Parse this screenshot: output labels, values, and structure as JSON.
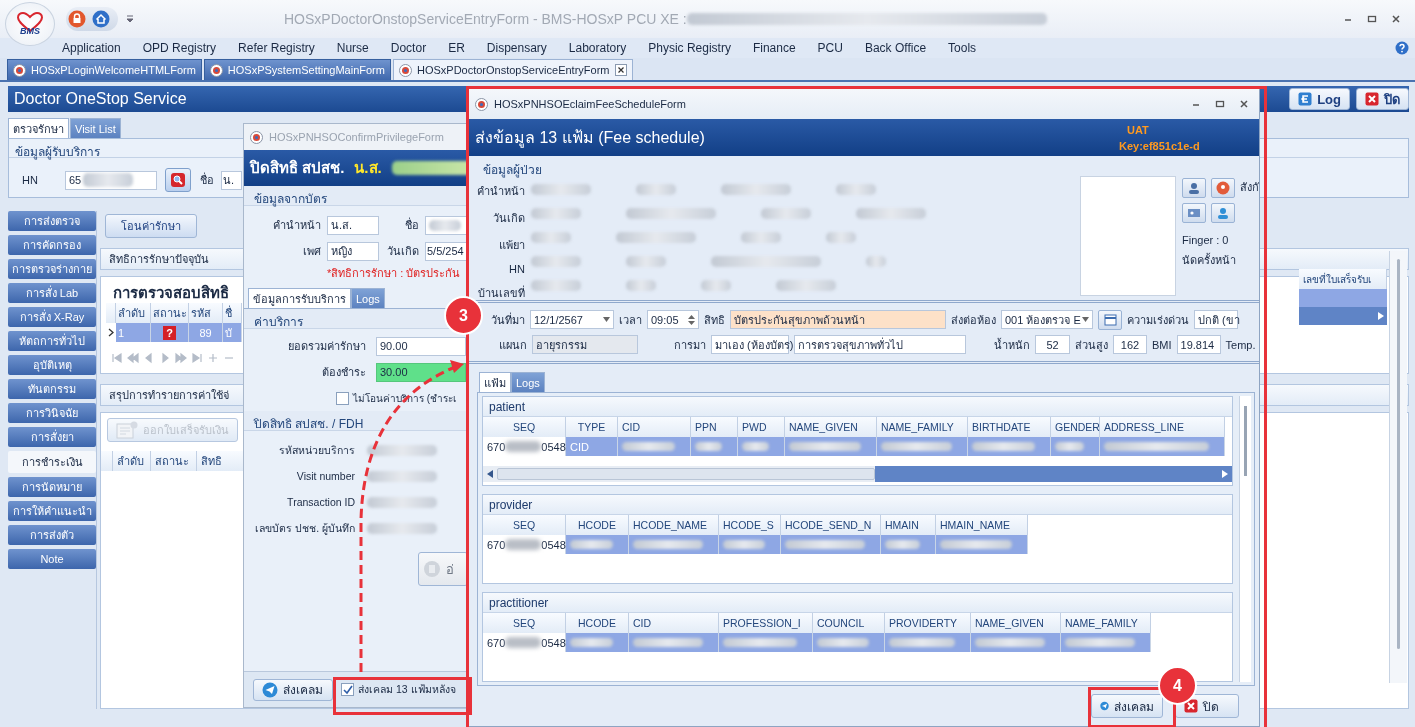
{
  "app_window": {
    "logo": "BMS",
    "title": "HOSxPDoctorOnstopServiceEntryForm - BMS-HOSxP PCU XE :"
  },
  "menu": [
    "Application",
    "OPD Registry",
    "Refer Registry",
    "Nurse",
    "Doctor",
    "ER",
    "Dispensary",
    "Laboratory",
    "Physic Registry",
    "Finance",
    "PCU",
    "Back Office",
    "Tools"
  ],
  "doc_tabs": [
    {
      "label": "HOSxPLoginWelcomeHTMLForm",
      "selected": false
    },
    {
      "label": "HOSxPSystemSettingMainForm",
      "selected": false
    },
    {
      "label": "HOSxPDoctorOnstopServiceEntryForm",
      "selected": true
    }
  ],
  "service": {
    "title": "Doctor OneStop Service",
    "buttons": [
      {
        "label": "Log",
        "kind": "log"
      },
      {
        "label": "ปิด",
        "kind": "close"
      }
    ],
    "tabs": [
      {
        "label": "ตรวจรักษา",
        "selected": true
      },
      {
        "label": "Visit List",
        "selected": false
      }
    ],
    "patient_group": {
      "title": "ข้อมูลผู้รับบริการ",
      "hn_label": "HN",
      "hn_value": "65",
      "name_label": "ชื่อ",
      "name_value": "น."
    },
    "nav": [
      {
        "label": "การส่งตรวจ",
        "selected": false
      },
      {
        "label": "การคัดกรอง",
        "selected": false
      },
      {
        "label": "การตรวจร่างกาย",
        "selected": false
      },
      {
        "label": "การสั่ง Lab",
        "selected": false
      },
      {
        "label": "การสั่ง X-Ray",
        "selected": false
      },
      {
        "label": "หัตถการทั่วไป",
        "selected": false
      },
      {
        "label": "อุบัติเหตุ",
        "selected": false
      },
      {
        "label": "ทันตกรรม",
        "selected": false
      },
      {
        "label": "การวินิจฉัย",
        "selected": false
      },
      {
        "label": "การสั่งยา",
        "selected": false
      },
      {
        "label": "การชำระเงิน",
        "selected": true
      },
      {
        "label": "การนัดหมาย",
        "selected": false
      },
      {
        "label": "การให้คำแนะนำ",
        "selected": false
      },
      {
        "label": "การส่งตัว",
        "selected": false
      },
      {
        "label": "Note",
        "selected": false
      }
    ],
    "transfer_button": "โอนค่ารักษา",
    "rights_panel": {
      "title": "สิทธิการรักษาปัจจุบัน",
      "grid_title": "การตรวจสอบสิทธิ",
      "columns": [
        "ลำดับ",
        "สถานะ",
        "รหัส",
        "ชื่"
      ],
      "rows": [
        {
          "selected": true,
          "cells": [
            "1",
            "?",
            "89",
            "บั"
          ]
        }
      ]
    },
    "receipt_grid": {
      "columns": [
        "เลขที่ใบเสร็จรับเ"
      ],
      "rows": [
        {
          "selected": true
        }
      ]
    },
    "expense_panel": {
      "title": "สรุปการทำรายการค่าใช้จ่",
      "receipt_button": {
        "label": "ออกใบเสร็จรับเงิน",
        "disabled": true
      },
      "columns": [
        "ลำดับ",
        "สถานะ",
        "สิทธิ"
      ]
    }
  },
  "privilege_window": {
    "title": "HOSxPNHSOConfirmPrivilegeForm",
    "heading": "ปิดสิทธิ สปสช.",
    "heading_name": "น.ส.",
    "card_group": "ข้อมูลจากบัตร",
    "prefix": {
      "label": "คำนำหน้า",
      "value": "น.ส."
    },
    "first_name": {
      "label": "ชื่อ"
    },
    "sex": {
      "label": "เพศ",
      "value": "หญิง"
    },
    "birth": {
      "label": "วันเกิด",
      "value": "5/5/254"
    },
    "right_note": "*สิทธิการรักษา : บัตรประกัน",
    "tabs": [
      {
        "label": "ข้อมูลการรับบริการ",
        "selected": true
      },
      {
        "label": "Logs",
        "selected": false
      }
    ],
    "fee_group": "ค่าบริการ",
    "total": {
      "label": "ยอดรวมค่ารักษา",
      "value": "90.00"
    },
    "payable": {
      "label": "ต้องชำระ",
      "value": "30.00"
    },
    "no_transfer": {
      "label": "ไม่โอนค่าบริการ (ชำระเ",
      "checked": false
    },
    "close_group": "ปิดสิทธิ สปสช. / FDH",
    "close_fields": [
      "รหัสหน่วยบริการ",
      "Visit number",
      "Transaction ID",
      "เลขบัตร ปชช. ผู้บันทึก"
    ],
    "read_button": {
      "label": "อ่",
      "disabled": true
    },
    "claim_button": "ส่งเคลม",
    "send13": {
      "label": "ส่งเคลม 13 แฟ้มหลังจ",
      "checked": true
    }
  },
  "fee_window": {
    "title": "HOSxPNHSOEclaimFeeScheduleForm",
    "heading": "ส่งข้อมูล 13 แฟ้ม (Fee schedule)",
    "env": "UAT",
    "key": "Key:ef851c1e-d",
    "patient_group": "ข้อมูลผู้ป่วย",
    "patient_labels": [
      "คำนำหน้า",
      "วันเกิด",
      "แพ้ยา",
      "HN",
      "บ้านเลขที่"
    ],
    "affiliation": "สังกั",
    "finger": "Finger : 0",
    "next_appt": "นัดครั้งหน้า",
    "visit_date": {
      "label": "วันที่มา",
      "value": "12/1/2567"
    },
    "time": {
      "label": "เวลา",
      "value": "09:05"
    },
    "right": {
      "label": "สิทธิ",
      "value": "บัตรประกันสุขภาพถ้วนหน้า"
    },
    "room": {
      "label": "ส่งต่อห้อง",
      "value": "001 ห้องตรวจ E"
    },
    "urgency": {
      "label": "ความเร่งด่วน",
      "value": "ปกติ (ขา"
    },
    "dept": {
      "label": "แผนก",
      "value": "อายุรกรรม"
    },
    "arrival": {
      "label": "การมา",
      "value": "มาเอง (ห้องบัตร)",
      "detail": "การตรวจสุขภาพทั่วไป"
    },
    "weight": {
      "label": "น้ำหนัก",
      "value": "52"
    },
    "height": {
      "label": "ส่วนสูง",
      "value": "162"
    },
    "bmi": {
      "label": "BMI",
      "value": "19.814"
    },
    "temp": {
      "label": "Temp."
    },
    "tabs": [
      {
        "label": "แฟ้ม",
        "selected": true
      },
      {
        "label": "Logs",
        "selected": false
      }
    ],
    "tables": [
      {
        "title": "patient",
        "columns": [
          "SEQ",
          "TYPE",
          "CID",
          "PPN",
          "PWD",
          "NAME_GIVEN",
          "NAME_FAMILY",
          "BIRTHDATE",
          "GENDER",
          "ADDRESS_LINE"
        ],
        "rows": [
          {
            "selected": true,
            "cells": [
              [
                "670",
                "0548"
              ],
              "CID"
            ]
          }
        ]
      },
      {
        "title": "provider",
        "columns": [
          "SEQ",
          "HCODE",
          "HCODE_NAME",
          "HCODE_S",
          "HCODE_SEND_N",
          "HMAIN",
          "HMAIN_NAME"
        ],
        "rows": [
          {
            "selected": true,
            "cells": [
              [
                "670",
                "0548"
              ]
            ]
          }
        ]
      },
      {
        "title": "practitioner",
        "columns": [
          "SEQ",
          "HCODE",
          "CID",
          "PROFESSION_I",
          "COUNCIL",
          "PROVIDERTY",
          "NAME_GIVEN",
          "NAME_FAMILY"
        ],
        "rows": [
          {
            "selected": true,
            "cells": [
              [
                "670",
                "0548"
              ]
            ]
          }
        ]
      }
    ],
    "buttons": [
      {
        "label": "ส่งเคลม",
        "kind": "send"
      },
      {
        "label": "ปิด",
        "kind": "close"
      }
    ]
  },
  "annotations": [
    {
      "kind": "frame"
    },
    {
      "kind": "frame"
    },
    {
      "kind": "frame"
    },
    {
      "kind": "arrow"
    },
    {
      "kind": "step",
      "text": "3"
    },
    {
      "kind": "step",
      "text": "4"
    }
  ]
}
